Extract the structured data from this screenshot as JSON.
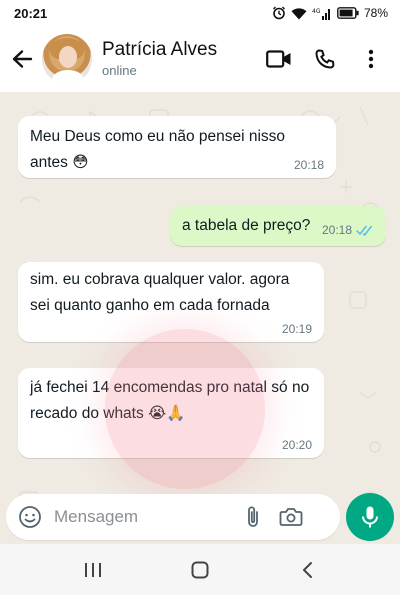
{
  "status_bar": {
    "time": "20:21",
    "battery_percent": "78%",
    "icons": [
      "alarm-icon",
      "wifi-icon",
      "signal-4g-icon",
      "battery-icon"
    ]
  },
  "header": {
    "contact_name": "Patrícia Alves",
    "contact_status": "online",
    "icons": [
      "back-arrow-icon",
      "video-call-icon",
      "voice-call-icon",
      "more-vert-icon"
    ]
  },
  "messages": [
    {
      "direction": "incoming",
      "text": "Meu Deus como eu não pensei nisso antes 😳",
      "time": "20:18"
    },
    {
      "direction": "outgoing",
      "text": "a tabela de preço?",
      "time": "20:18",
      "read": true
    },
    {
      "direction": "incoming",
      "text": "sim. eu cobrava qualquer valor. agora sei quanto ganho em cada fornada",
      "time": "20:19"
    },
    {
      "direction": "incoming",
      "text": "já fechei 14 encomendas pro natal só no recado do whats 😭🙏",
      "time": "20:20"
    }
  ],
  "composer": {
    "placeholder": "Mensagem",
    "icons": [
      "emoji-icon",
      "attach-icon",
      "camera-icon",
      "mic-icon"
    ]
  },
  "colors": {
    "chat_background": "#efeae2",
    "incoming_bubble": "#ffffff",
    "outgoing_bubble": "#dcf8c6",
    "accent": "#00a884",
    "read_ticks": "#53bdeb"
  }
}
